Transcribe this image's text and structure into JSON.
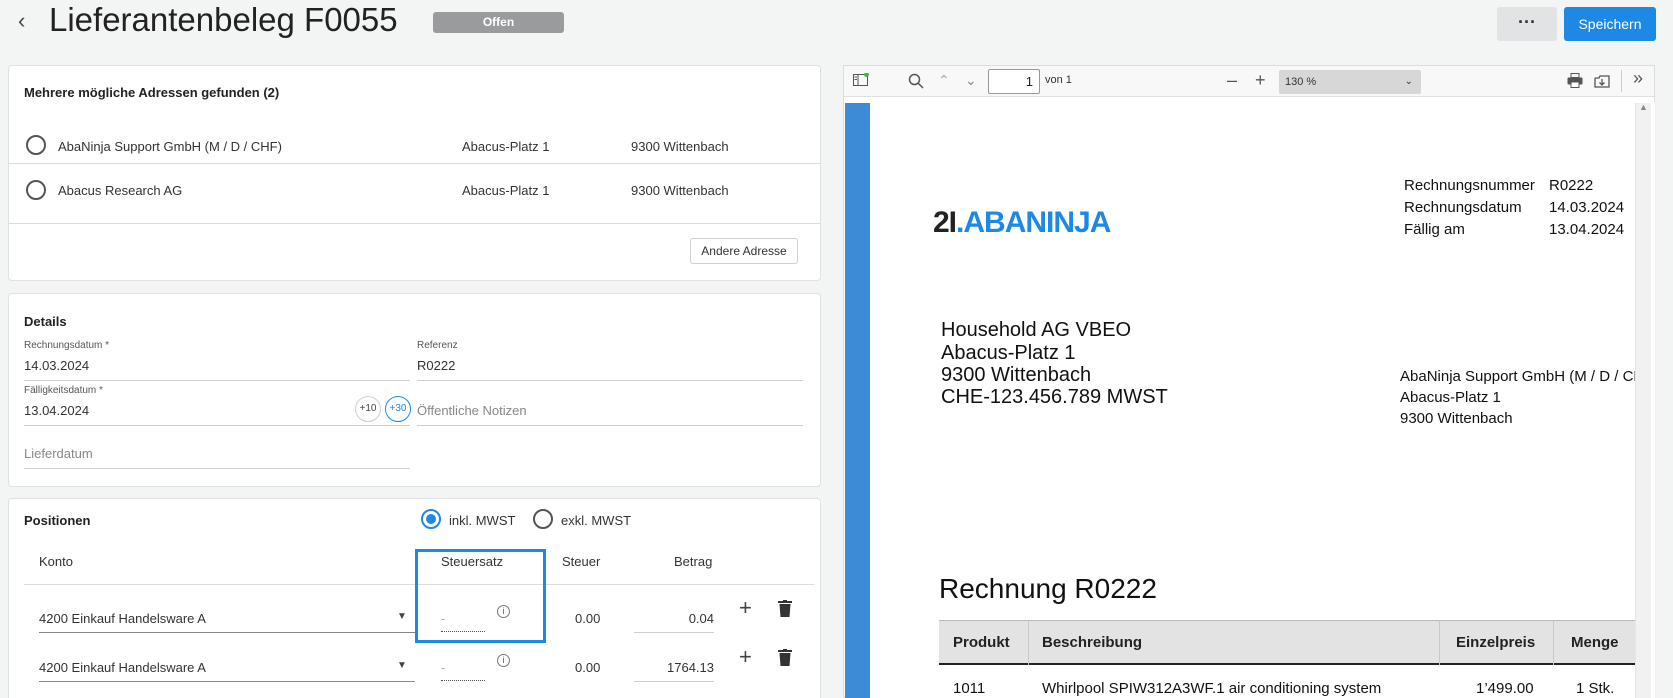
{
  "header": {
    "title": "Lieferantenbeleg F0055",
    "status": "Offen",
    "more_label": "···",
    "save_label": "Speichern"
  },
  "addresses": {
    "title": "Mehrere mögliche Adressen gefunden (2)",
    "items": [
      {
        "name": "AbaNinja Support GmbH (M / D / CHF)",
        "street": "Abacus-Platz 1",
        "city": "9300 Wittenbach"
      },
      {
        "name": "Abacus Research AG",
        "street": "Abacus-Platz 1",
        "city": "9300 Wittenbach"
      }
    ],
    "other_button": "Andere Adresse"
  },
  "details": {
    "title": "Details",
    "invoice_date_label": "Rechnungsdatum *",
    "invoice_date": "14.03.2024",
    "reference_label": "Referenz",
    "reference": "R0222",
    "due_date_label": "Fälligkeitsdatum *",
    "due_date": "13.04.2024",
    "plus10": "+10",
    "plus30": "+30",
    "public_notes_placeholder": "Öffentliche Notizen",
    "delivery_date_placeholder": "Lieferdatum"
  },
  "positions": {
    "title": "Positionen",
    "incl_label": "inkl. MWST",
    "excl_label": "exkl. MWST",
    "vat_mode": "incl",
    "columns": [
      "Konto",
      "Steuersatz",
      "Steuer",
      "Betrag"
    ],
    "rows": [
      {
        "account": "4200 Einkauf Handelsware A",
        "rate": "-",
        "tax": "0.00",
        "amount": "0.04"
      },
      {
        "account": "4200 Einkauf Handelsware A",
        "rate": "-",
        "tax": "0.00",
        "amount": "1764.13"
      }
    ]
  },
  "pdf_viewer": {
    "page": "1",
    "page_total": "von 1",
    "zoom": "130 %"
  },
  "invoice": {
    "logo_prefix": "2I",
    "logo_name": ".ABANINJA",
    "meta": [
      {
        "label": "Rechnungsnummer",
        "value": "R0222"
      },
      {
        "label": "Rechnungsdatum",
        "value": "14.03.2024"
      },
      {
        "label": "Fällig am",
        "value": "13.04.2024"
      }
    ],
    "sender": [
      "Household AG VBEO",
      "Abacus-Platz 1",
      "9300 Wittenbach",
      "CHE-123.456.789 MWST"
    ],
    "recipient": [
      "AbaNinja Support GmbH (M / D / CHF)",
      "Abacus-Platz 1",
      "9300 Wittenbach"
    ],
    "heading": "Rechnung R0222",
    "table_headers": [
      "Produkt",
      "Beschreibung",
      "Einzelpreis",
      "Menge"
    ],
    "table_rows": [
      {
        "product": "1011",
        "description": "Whirlpool SPIW312A3WF.1 air conditioning system",
        "price": "1’499.00",
        "qty": "1 Stk."
      }
    ]
  },
  "colors": {
    "accent": "#1e88e5",
    "badge": "#999b9d",
    "pdf_sidebar": "#3d8bd6",
    "logo_blue": "#1e88e5"
  }
}
